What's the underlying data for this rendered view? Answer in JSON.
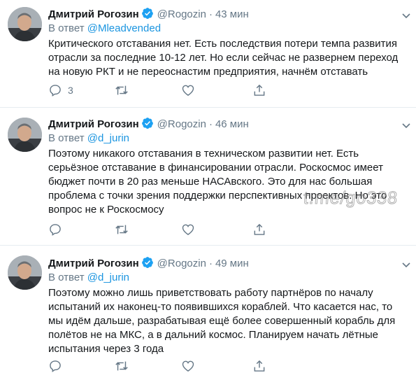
{
  "colors": {
    "link": "#1b95e0",
    "secondary_text": "#657786",
    "primary_text": "#14171a",
    "divider": "#e6ecf0",
    "verified": "#1da1f2"
  },
  "tweets": [
    {
      "name": "Дмитрий Рогозин",
      "handle": "@Rogozin",
      "separator": "·",
      "time": "43 мин",
      "reply_prefix": "В ответ",
      "reply_to": "@Mleadvended",
      "text_lines": [
        "Критического отставания нет. Есть последствия потери темпа развития",
        "отрасли за последние 10-12 лет. Но если сейчас не развернем переход",
        "на новую РКТ и не переоснастим предприятия, начнём отставать"
      ],
      "reply_count": "3",
      "retweet_count": "",
      "like_count": ""
    },
    {
      "name": "Дмитрий Рогозин",
      "handle": "@Rogozin",
      "separator": "·",
      "time": "46 мин",
      "reply_prefix": "В ответ",
      "reply_to": "@d_jurin",
      "text_lines": [
        "Поэтому никакого отставания в техническом развитии нет. Есть",
        "серьёзное отставание в финансировании отрасли. Роскосмос имеет",
        "бюджет почти в 20 раз меньше НАСАвского. Это для нас большая",
        "проблема с точки зрения поддержки перспективных проектов. Но это",
        "вопрос не к Роскосмосу"
      ],
      "reply_count": "",
      "retweet_count": "",
      "like_count": ""
    },
    {
      "name": "Дмитрий Рогозин",
      "handle": "@Rogozin",
      "separator": "·",
      "time": "49 мин",
      "reply_prefix": "В ответ",
      "reply_to": "@d_jurin",
      "text_lines": [
        "Поэтому можно лишь приветствовать работу партнёров по началу",
        "испытаний их наконец-то появившихся кораблей. Что касается нас, то",
        "мы идём дальше, разрабатывая ещё более совершенный корабль для",
        "полётов не на МКС, а в дальний космос. Планируем начать лётные",
        "испытания через 3 года"
      ],
      "reply_count": "",
      "retweet_count": "",
      "like_count": ""
    }
  ],
  "watermark": "t.me/go338",
  "icons": [
    "avatar-icon",
    "verified-badge-icon",
    "chevron-down-icon",
    "reply-icon",
    "retweet-icon",
    "like-icon",
    "share-icon"
  ]
}
